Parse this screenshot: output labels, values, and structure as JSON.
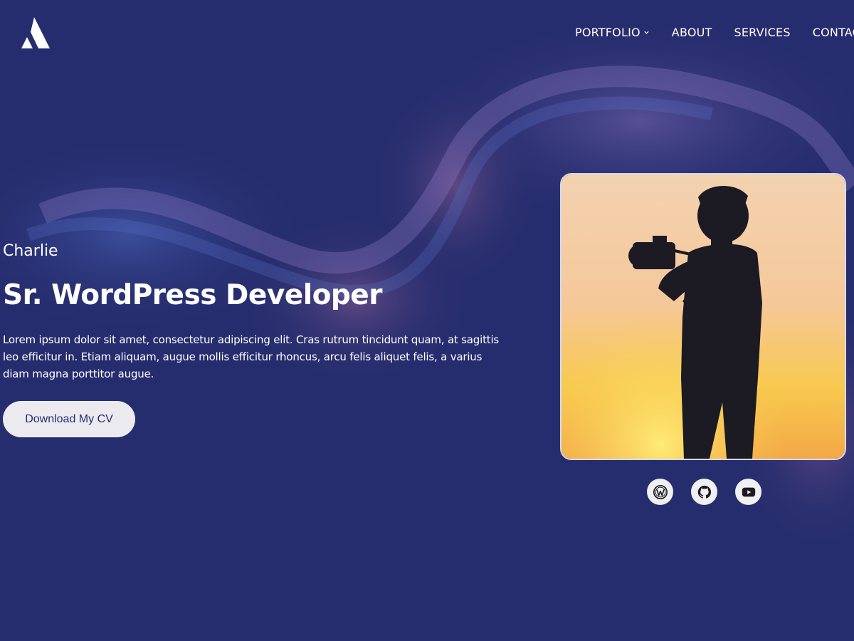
{
  "header": {
    "logo_icon": "triangle-a-logo",
    "nav": [
      {
        "label": "PORTFOLIO",
        "has_dropdown": true
      },
      {
        "label": "ABOUT",
        "has_dropdown": false
      },
      {
        "label": "SERVICES",
        "has_dropdown": false
      },
      {
        "label": "CONTACT",
        "has_dropdown": false
      }
    ]
  },
  "hero": {
    "name": "Charlie",
    "title": "Sr. WordPress Developer",
    "description": "Lorem ipsum dolor sit amet, consectetur adipiscing elit. Cras rutrum tincidunt quam, at sagittis leo efficitur in. Etiam aliquam, augue mollis efficitur rhoncus, arcu felis aliquet felis, a varius diam magna porttitor augue.",
    "cta_label": "Download My CV"
  },
  "profile": {
    "photo": "silhouette-photographer-sunset",
    "socials": [
      {
        "icon": "wordpress-icon"
      },
      {
        "icon": "github-icon"
      },
      {
        "icon": "youtube-icon"
      }
    ]
  },
  "colors": {
    "background": "#262d6e",
    "button_bg": "#ebebef",
    "button_text": "#262d6e",
    "sunset_top": "#f1cba5",
    "sunset_bottom": "#f6c13a"
  }
}
